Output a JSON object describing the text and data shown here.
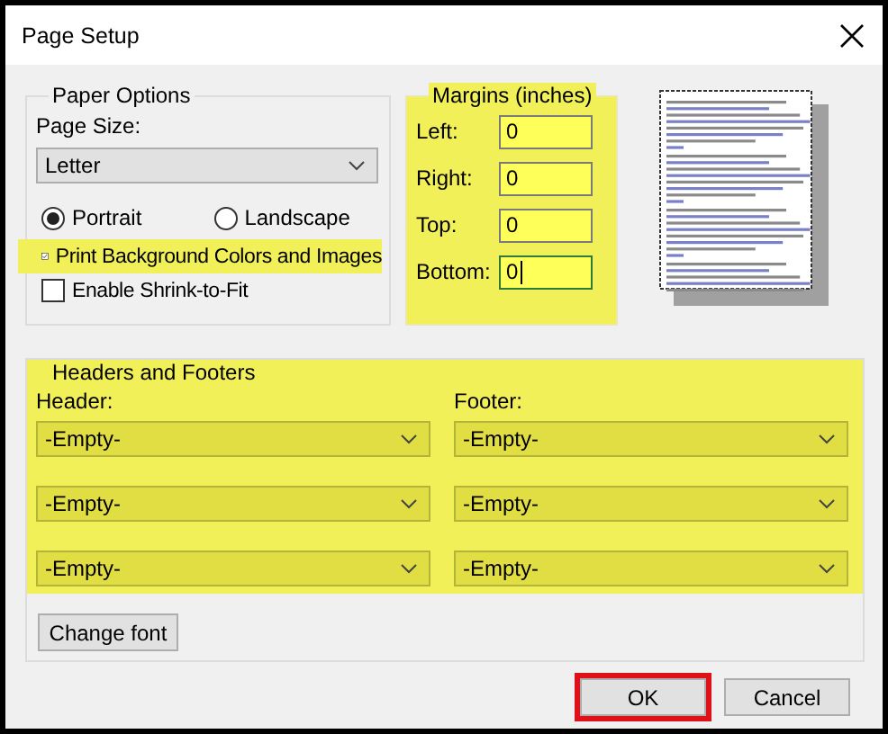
{
  "window": {
    "title": "Page Setup"
  },
  "paper_options": {
    "title": "Paper Options",
    "page_size_label": "Page Size:",
    "page_size": "Letter",
    "orientation": [
      {
        "label": "Portrait",
        "selected": true
      },
      {
        "label": "Landscape",
        "selected": false
      }
    ],
    "checkboxes": [
      {
        "label": "Print Background Colors and Images",
        "checked": true,
        "highlighted": true
      },
      {
        "label": "Enable Shrink-to-Fit",
        "checked": false,
        "highlighted": false
      }
    ]
  },
  "margins": {
    "title": "Margins (inches)",
    "highlighted": true,
    "fields": [
      {
        "label": "Left:",
        "value": "0",
        "focused": false
      },
      {
        "label": "Right:",
        "value": "0",
        "focused": false
      },
      {
        "label": "Top:",
        "value": "0",
        "focused": false
      },
      {
        "label": "Bottom:",
        "value": "0",
        "focused": true
      }
    ]
  },
  "headers_footers": {
    "title": "Headers and Footers",
    "highlighted": true,
    "header_label": "Header:",
    "footer_label": "Footer:",
    "rows": [
      {
        "header": "-Empty-",
        "footer": "-Empty-"
      },
      {
        "header": "-Empty-",
        "footer": "-Empty-"
      },
      {
        "header": "-Empty-",
        "footer": "-Empty-"
      }
    ],
    "change_font": "Change font"
  },
  "buttons": [
    {
      "label": "OK",
      "highlighted": true
    },
    {
      "label": "Cancel",
      "highlighted": false
    }
  ]
}
